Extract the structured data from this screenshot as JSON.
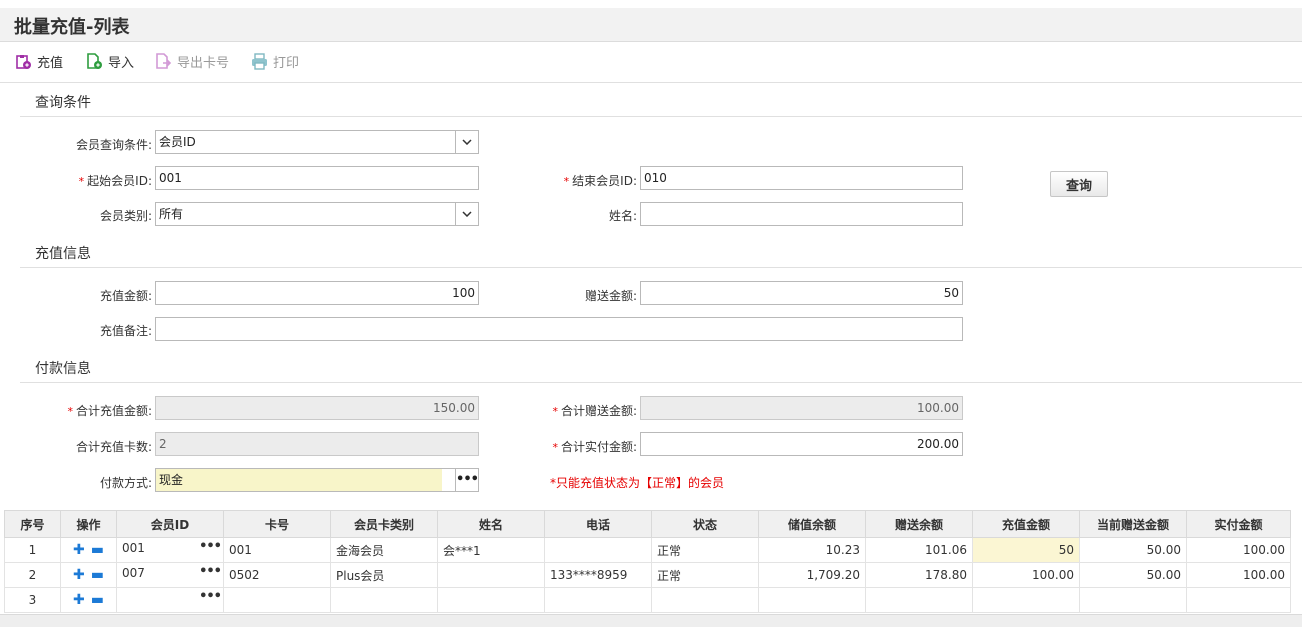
{
  "page": {
    "title": "批量充值-列表"
  },
  "toolbar": {
    "recharge": "充值",
    "import": "导入",
    "export_cards": "导出卡号",
    "print": "打印"
  },
  "query": {
    "section_title": "查询条件",
    "condition_label": "会员查询条件:",
    "condition_value": "会员ID",
    "start_id_label": "起始会员ID:",
    "start_id_value": "001",
    "end_id_label": "结束会员ID:",
    "end_id_value": "010",
    "type_label": "会员类别:",
    "type_value": "所有",
    "name_label": "姓名:",
    "name_value": "",
    "query_button": "查询"
  },
  "recharge_info": {
    "section_title": "充值信息",
    "amount_label": "充值金额:",
    "amount_value": "100",
    "gift_label": "赠送金额:",
    "gift_value": "50",
    "remark_label": "充值备注:",
    "remark_value": ""
  },
  "payment": {
    "section_title": "付款信息",
    "total_recharge_label": "合计充值金额:",
    "total_recharge_value": "150.00",
    "total_gift_label": "合计赠送金额:",
    "total_gift_value": "100.00",
    "card_count_label": "合计充值卡数:",
    "card_count_value": "2",
    "total_paid_label": "合计实付金额:",
    "total_paid_value": "200.00",
    "method_label": "付款方式:",
    "method_value": "现金",
    "note": "*只能充值状态为【正常】的会员"
  },
  "grid": {
    "headers": [
      "序号",
      "操作",
      "会员ID",
      "卡号",
      "会员卡类别",
      "姓名",
      "电话",
      "状态",
      "储值余额",
      "赠送余额",
      "充值金额",
      "当前赠送金额",
      "实付金额"
    ],
    "rows": [
      [
        "1",
        "",
        "001",
        "001",
        "金海会员",
        "会***1",
        "",
        "正常",
        "10.23",
        "101.06",
        "50",
        "50.00",
        "100.00"
      ],
      [
        "2",
        "",
        "007",
        "0502",
        "Plus会员",
        "",
        "133****8959",
        "正常",
        "1,709.20",
        "178.80",
        "100.00",
        "50.00",
        "100.00"
      ],
      [
        "3",
        "",
        "",
        "",
        "",
        "",
        "",
        "",
        "",
        "",
        "",
        "",
        ""
      ]
    ]
  },
  "colors": {
    "required": "#e60000",
    "highlight": "#fbf6d3",
    "accent": "#1c7ad6"
  }
}
